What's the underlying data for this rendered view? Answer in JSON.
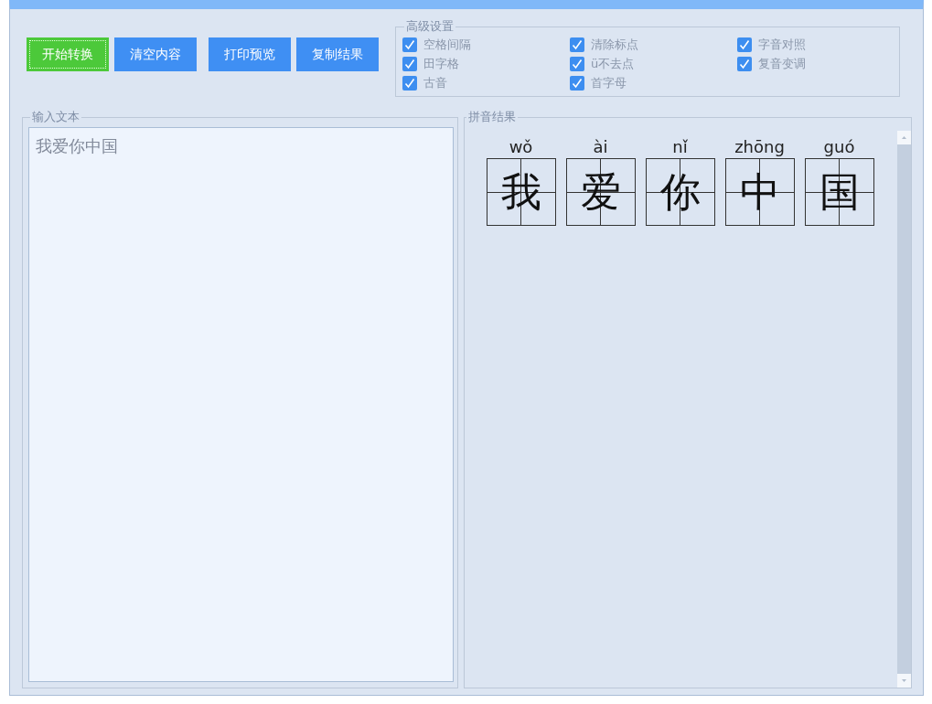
{
  "buttons": [
    {
      "label": "开始转换",
      "color": "#4cc93a"
    },
    {
      "label": "清空内容",
      "color": "#3f8ff3"
    },
    {
      "label": "打印预览",
      "color": "#3f8ff3"
    },
    {
      "label": "复制结果",
      "color": "#3f8ff3"
    }
  ],
  "advanced_settings": {
    "title": "高级设置",
    "options": [
      {
        "label": "空格间隔",
        "checked": true
      },
      {
        "label": "清除标点",
        "checked": true
      },
      {
        "label": "字音对照",
        "checked": true
      },
      {
        "label": "田字格",
        "checked": true
      },
      {
        "label": "ü不去点",
        "checked": true
      },
      {
        "label": "复音变调",
        "checked": true
      },
      {
        "label": "古音",
        "checked": true
      },
      {
        "label": "首字母",
        "checked": true
      }
    ]
  },
  "input_panel": {
    "title": "输入文本",
    "value": "我爱你中国"
  },
  "result_panel": {
    "title": "拼音结果",
    "characters": [
      {
        "pinyin": "wǒ",
        "hanzi": "我"
      },
      {
        "pinyin": "ài",
        "hanzi": "爱"
      },
      {
        "pinyin": "nǐ",
        "hanzi": "你"
      },
      {
        "pinyin": "zhōng",
        "hanzi": "中"
      },
      {
        "pinyin": "guó",
        "hanzi": "国"
      }
    ]
  }
}
